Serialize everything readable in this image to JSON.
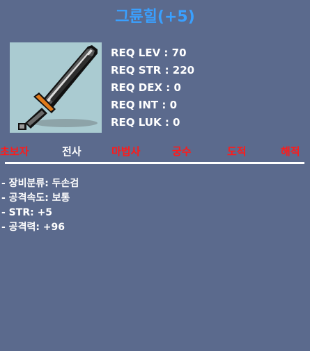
{
  "item": {
    "title": "그륜힐(+5)",
    "icon": "two-handed-sword-icon"
  },
  "requirements": [
    "REQ LEV : 70",
    "REQ STR : 220",
    "REQ DEX : 0",
    "REQ INT : 0",
    "REQ LUK : 0"
  ],
  "jobs": [
    {
      "label": "초보자",
      "color": "#ff1a1a"
    },
    {
      "label": "전사",
      "color": "#ffffff"
    },
    {
      "label": "마법사",
      "color": "#ff1a1a"
    },
    {
      "label": "궁수",
      "color": "#ff1a1a"
    },
    {
      "label": "도적",
      "color": "#ff1a1a"
    },
    {
      "label": "해적",
      "color": "#ff1a1a"
    }
  ],
  "stats": [
    "- 장비분류: 두손검",
    "- 공격속도: 보통",
    "- STR: +5",
    "- 공격력: +96"
  ],
  "colors": {
    "background": "#5b6a8d",
    "title": "#3aa0ff",
    "icon_background": "#aacbd1",
    "unavailable_job": "#ff1a1a",
    "available_job": "#ffffff"
  }
}
